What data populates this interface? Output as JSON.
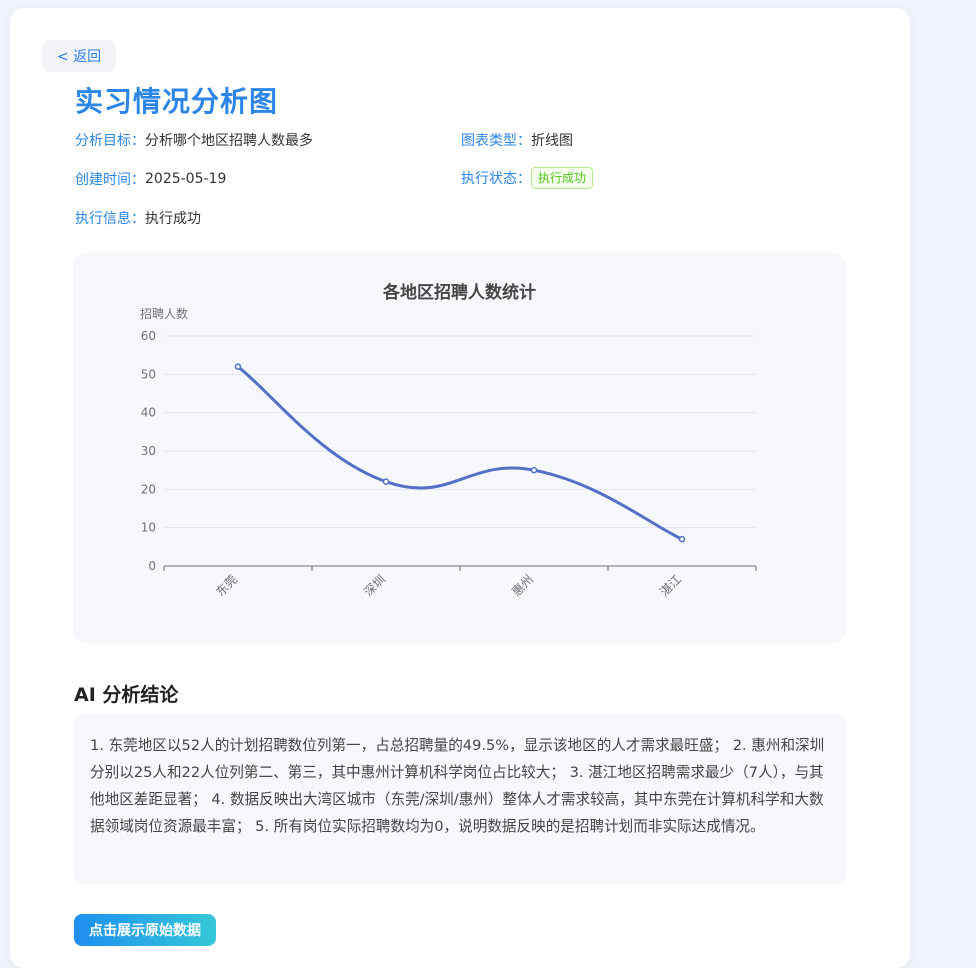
{
  "back_label": "< 返回",
  "page_title": "实习情况分析图",
  "meta": {
    "goal_key": "分析目标：",
    "goal_val": "分析哪个地区招聘人数最多",
    "type_key": "图表类型：",
    "type_val": "折线图",
    "created_key": "创建时间：",
    "created_val": "2025-05-19",
    "status_key": "执行状态：",
    "status_val": "执行成功",
    "info_key": "执行信息：",
    "info_val": "执行成功"
  },
  "chart_data": {
    "type": "line",
    "title": "各地区招聘人数统计",
    "ylabel": "招聘人数",
    "xlabel": "",
    "categories": [
      "东莞",
      "深圳",
      "惠州",
      "湛江"
    ],
    "series": [
      {
        "values": [
          52,
          22,
          25,
          7
        ],
        "color": "#5470c6"
      }
    ],
    "ylim": [
      0,
      60
    ],
    "yticks": [
      0,
      10,
      20,
      30,
      40,
      50,
      60
    ],
    "smooth": true,
    "grid": true
  },
  "section_title": "AI 分析结论",
  "conclusion_text": "1. 东莞地区以52人的计划招聘数位列第一，占总招聘量的49.5%，显示该地区的人才需求最旺盛； 2. 惠州和深圳分别以25人和22人位列第二、第三，其中惠州计算机科学岗位占比较大； 3. 湛江地区招聘需求最少（7人），与其他地区差距显著； 4. 数据反映出大湾区城市（东莞/深圳/惠州）整体人才需求较高，其中东莞在计算机科学和大数据领域岗位资源最丰富； 5. 所有岗位实际招聘数均为0，说明数据反映的是招聘计划而非实际达成情况。",
  "raw_button_label": "点击展示原始数据"
}
